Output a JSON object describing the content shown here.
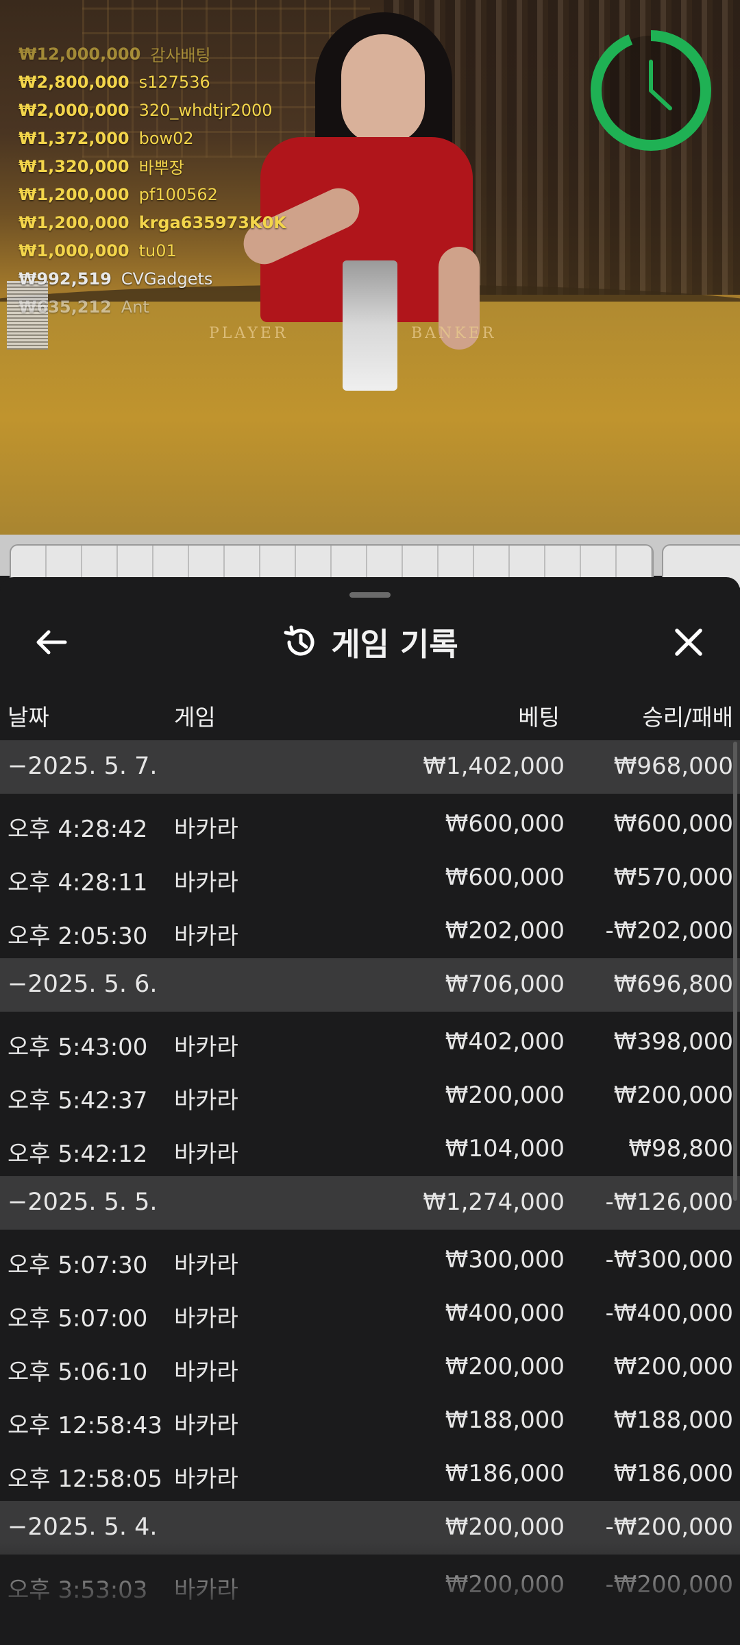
{
  "bettors": [
    {
      "amount": "₩12,000,000",
      "name": "감사배팅",
      "style": "gold faded"
    },
    {
      "amount": "₩2,800,000",
      "name": "s127536",
      "style": "gold"
    },
    {
      "amount": "₩2,000,000",
      "name": "320_whdtjr2000",
      "style": "gold"
    },
    {
      "amount": "₩1,372,000",
      "name": "bow02",
      "style": "gold"
    },
    {
      "amount": "₩1,320,000",
      "name": "바뿌장",
      "style": "gold"
    },
    {
      "amount": "₩1,200,000",
      "name": "pf100562",
      "style": "gold"
    },
    {
      "amount": "₩1,200,000",
      "name": "krga635973K0K",
      "style": "gold bold"
    },
    {
      "amount": "₩1,000,000",
      "name": "tu01",
      "style": "gold"
    },
    {
      "amount": "₩992,519",
      "name": "CVGadgets",
      "style": "white"
    },
    {
      "amount": "₩635,212",
      "name": "Ant",
      "style": "white faded"
    }
  ],
  "table_labels": {
    "player": "PLAYER",
    "banker": "BANKER"
  },
  "sheet": {
    "title": "게임 기록",
    "columns": {
      "date": "날짜",
      "game": "게임",
      "bet": "베팅",
      "winloss": "승리/패배"
    }
  },
  "history": [
    {
      "type": "group",
      "date": "−2025. 5. 7.",
      "bet": "₩1,402,000",
      "winloss": "₩968,000"
    },
    {
      "type": "item",
      "time": "오후 4:28:42",
      "game": "바카라",
      "bet": "₩600,000",
      "winloss": "₩600,000"
    },
    {
      "type": "item",
      "time": "오후 4:28:11",
      "game": "바카라",
      "bet": "₩600,000",
      "winloss": "₩570,000"
    },
    {
      "type": "item",
      "time": "오후 2:05:30",
      "game": "바카라",
      "bet": "₩202,000",
      "winloss": "-₩202,000"
    },
    {
      "type": "group",
      "date": "−2025. 5. 6.",
      "bet": "₩706,000",
      "winloss": "₩696,800"
    },
    {
      "type": "item",
      "time": "오후 5:43:00",
      "game": "바카라",
      "bet": "₩402,000",
      "winloss": "₩398,000"
    },
    {
      "type": "item",
      "time": "오후 5:42:37",
      "game": "바카라",
      "bet": "₩200,000",
      "winloss": "₩200,000"
    },
    {
      "type": "item",
      "time": "오후 5:42:12",
      "game": "바카라",
      "bet": "₩104,000",
      "winloss": "₩98,800"
    },
    {
      "type": "group",
      "date": "−2025. 5. 5.",
      "bet": "₩1,274,000",
      "winloss": "-₩126,000"
    },
    {
      "type": "item",
      "time": "오후 5:07:30",
      "game": "바카라",
      "bet": "₩300,000",
      "winloss": "-₩300,000"
    },
    {
      "type": "item",
      "time": "오후 5:07:00",
      "game": "바카라",
      "bet": "₩400,000",
      "winloss": "-₩400,000"
    },
    {
      "type": "item",
      "time": "오후 5:06:10",
      "game": "바카라",
      "bet": "₩200,000",
      "winloss": "₩200,000"
    },
    {
      "type": "item",
      "time": "오후 12:58:43",
      "game": "바카라",
      "bet": "₩188,000",
      "winloss": "₩188,000"
    },
    {
      "type": "item",
      "time": "오후 12:58:05",
      "game": "바카라",
      "bet": "₩186,000",
      "winloss": "₩186,000"
    },
    {
      "type": "group",
      "date": "−2025. 5. 4.",
      "bet": "₩200,000",
      "winloss": "-₩200,000"
    },
    {
      "type": "item",
      "time": "오후 3:53:03",
      "game": "바카라",
      "bet": "₩200,000",
      "winloss": "-₩200,000"
    }
  ],
  "colors": {
    "gold_text": "#f3d54b",
    "timer_green": "#1fb154",
    "sheet_bg": "#1b1b1c",
    "group_row_bg": "#3a3a3b"
  },
  "icons": {
    "back": "arrow-left-icon",
    "history": "history-icon",
    "close": "close-icon",
    "timer": "timer-icon"
  }
}
